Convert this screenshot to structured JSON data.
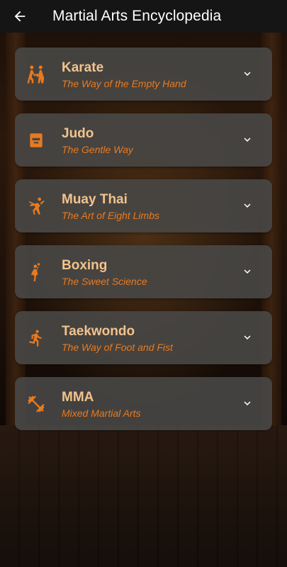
{
  "header": {
    "title": "Martial Arts Encyclopedia"
  },
  "colors": {
    "accent": "#e97a1f",
    "name": "#f1c38d",
    "card": "#484644",
    "appbar": "#151515"
  },
  "arts": [
    {
      "name": "Karate",
      "subtitle": "The Way of the Empty Hand",
      "icon": "sparring-icon"
    },
    {
      "name": "Judo",
      "subtitle": "The Gentle Way",
      "icon": "sports-icon"
    },
    {
      "name": "Muay Thai",
      "subtitle": "The Art of Eight Limbs",
      "icon": "kick-icon"
    },
    {
      "name": "Boxing",
      "subtitle": "The Sweet Science",
      "icon": "handball-icon"
    },
    {
      "name": "Taekwondo",
      "subtitle": "The Way of Foot and Fist",
      "icon": "running-icon"
    },
    {
      "name": "MMA",
      "subtitle": "Mixed Martial Arts",
      "icon": "dumbbell-icon"
    }
  ]
}
